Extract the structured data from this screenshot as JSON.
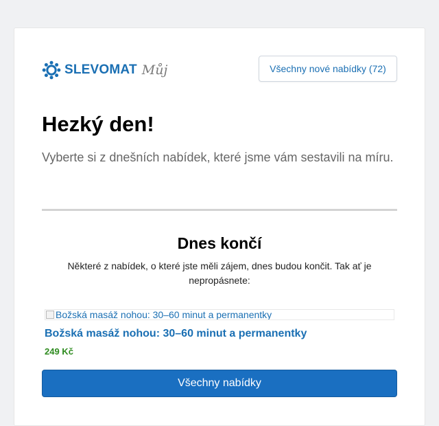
{
  "colors": {
    "brand_blue": "#1a6fb3",
    "button_blue": "#1a6fc1",
    "price_green": "#2e8b1f",
    "page_background": "#f0f1f3"
  },
  "header": {
    "logo_icon": "gear-icon",
    "logo_text": "SLEVOMAT",
    "logo_suffix": "Můj",
    "all_new_offers_button": "Všechny nové nabídky (72)"
  },
  "greeting": {
    "title": "Hezký den!",
    "subtitle": "Vyberte si z dnešních nabídek, které jsme vám sestavili na míru."
  },
  "ending_today": {
    "title": "Dnes končí",
    "description": "Některé z nabídek, o které jste měli zájem, dnes budou končit. Tak ať je nepropásnete:",
    "deal": {
      "image_alt": "Božská masáž nohou: 30–60 minut a permanentky",
      "title": "Božská masáž nohou: 30–60 minut a permanentky",
      "price": "249 Kč"
    }
  },
  "footer": {
    "all_offers_button": "Všechny nabídky"
  }
}
